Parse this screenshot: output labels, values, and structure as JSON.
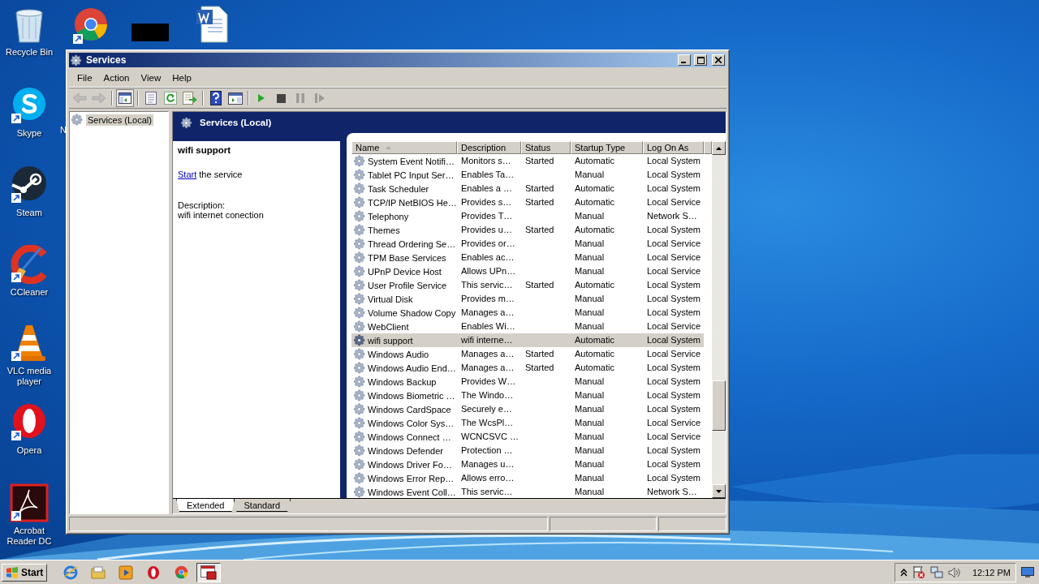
{
  "desktop_icons": [
    {
      "kind": "recycle",
      "label": "Recycle Bin"
    },
    {
      "kind": "chrome"
    },
    {
      "kind": "redacted"
    },
    {
      "kind": "word"
    },
    {
      "kind": "skype",
      "label": "Skype"
    },
    {
      "kind": "covered",
      "label": "N"
    },
    {
      "kind": "steam",
      "label": "Steam"
    },
    {
      "kind": "ccleaner",
      "label": "CCleaner"
    },
    {
      "kind": "vlc",
      "label": "VLC media player"
    },
    {
      "kind": "opera",
      "label": "Opera"
    },
    {
      "kind": "acrobat",
      "label": "Acrobat Reader DC"
    }
  ],
  "window": {
    "title": "Services",
    "menu": [
      "File",
      "Action",
      "View",
      "Help"
    ],
    "toolbar": [
      {
        "kind": "back",
        "disabled": true,
        "pressed": false
      },
      {
        "kind": "forward",
        "disabled": true,
        "pressed": false
      },
      {
        "kind": "tree",
        "disabled": false,
        "pressed": true
      },
      {
        "kind": "properties",
        "disabled": false,
        "pressed": false
      },
      {
        "kind": "refresh",
        "disabled": false,
        "pressed": false
      },
      {
        "kind": "export",
        "disabled": false,
        "pressed": false
      },
      {
        "kind": "help",
        "disabled": false,
        "pressed": false
      },
      {
        "kind": "console",
        "disabled": false,
        "pressed": false
      },
      {
        "kind": "play",
        "disabled": false,
        "pressed": false
      },
      {
        "kind": "stop",
        "disabled": false,
        "pressed": false
      },
      {
        "kind": "pause",
        "disabled": true,
        "pressed": false
      },
      {
        "kind": "resume",
        "disabled": true,
        "pressed": false
      }
    ],
    "tree": [
      {
        "label": "Services (Local)",
        "selected": true
      }
    ],
    "pane_title": "Services (Local)",
    "details": {
      "title": "wifi support",
      "action_link": "Start",
      "action_text": " the service",
      "description_label": "Description:",
      "description": "wifi internet conection"
    },
    "table": {
      "columns": [
        {
          "label": "Name",
          "sorted": true
        },
        {
          "label": "Description",
          "sorted": false
        },
        {
          "label": "Status",
          "sorted": false
        },
        {
          "label": "Startup Type",
          "sorted": false
        },
        {
          "label": "Log On As",
          "sorted": false
        }
      ],
      "rows": [
        {
          "name": "System Event Notifi…",
          "description": "Monitors s…",
          "status": "Started",
          "startup_type": "Automatic",
          "log_on_as": "Local System",
          "selected": false
        },
        {
          "name": "Tablet PC Input Ser…",
          "description": "Enables Ta…",
          "startup_type": "Manual",
          "log_on_as": "Local System",
          "selected": false
        },
        {
          "name": "Task Scheduler",
          "description": "Enables a …",
          "status": "Started",
          "startup_type": "Automatic",
          "log_on_as": "Local System",
          "selected": false
        },
        {
          "name": "TCP/IP NetBIOS He…",
          "description": "Provides s…",
          "status": "Started",
          "startup_type": "Automatic",
          "log_on_as": "Local Service",
          "selected": false
        },
        {
          "name": "Telephony",
          "description": "Provides T…",
          "startup_type": "Manual",
          "log_on_as": "Network S…",
          "selected": false
        },
        {
          "name": "Themes",
          "description": "Provides u…",
          "status": "Started",
          "startup_type": "Automatic",
          "log_on_as": "Local System",
          "selected": false
        },
        {
          "name": "Thread Ordering Se…",
          "description": "Provides or…",
          "startup_type": "Manual",
          "log_on_as": "Local Service",
          "selected": false
        },
        {
          "name": "TPM Base Services",
          "description": "Enables ac…",
          "startup_type": "Manual",
          "log_on_as": "Local Service",
          "selected": false
        },
        {
          "name": "UPnP Device Host",
          "description": "Allows UPn…",
          "startup_type": "Manual",
          "log_on_as": "Local Service",
          "selected": false
        },
        {
          "name": "User Profile Service",
          "description": "This servic…",
          "status": "Started",
          "startup_type": "Automatic",
          "log_on_as": "Local System",
          "selected": false
        },
        {
          "name": "Virtual Disk",
          "description": "Provides m…",
          "startup_type": "Manual",
          "log_on_as": "Local System",
          "selected": false
        },
        {
          "name": "Volume Shadow Copy",
          "description": "Manages a…",
          "startup_type": "Manual",
          "log_on_as": "Local System",
          "selected": false
        },
        {
          "name": "WebClient",
          "description": "Enables Wi…",
          "startup_type": "Manual",
          "log_on_as": "Local Service",
          "selected": false
        },
        {
          "name": "wifi support",
          "description": "wifi interne…",
          "startup_type": "Automatic",
          "log_on_as": "Local System",
          "selected": true
        },
        {
          "name": "Windows Audio",
          "description": "Manages a…",
          "status": "Started",
          "startup_type": "Automatic",
          "log_on_as": "Local Service",
          "selected": false
        },
        {
          "name": "Windows Audio End…",
          "description": "Manages a…",
          "status": "Started",
          "startup_type": "Automatic",
          "log_on_as": "Local System",
          "selected": false
        },
        {
          "name": "Windows Backup",
          "description": "Provides W…",
          "startup_type": "Manual",
          "log_on_as": "Local System",
          "selected": false
        },
        {
          "name": "Windows Biometric …",
          "description": "The Windo…",
          "startup_type": "Manual",
          "log_on_as": "Local System",
          "selected": false
        },
        {
          "name": "Windows CardSpace",
          "description": "Securely e…",
          "startup_type": "Manual",
          "log_on_as": "Local System",
          "selected": false
        },
        {
          "name": "Windows Color Sys…",
          "description": "The WcsPl…",
          "startup_type": "Manual",
          "log_on_as": "Local Service",
          "selected": false
        },
        {
          "name": "Windows Connect …",
          "description": "WCNCSVC …",
          "startup_type": "Manual",
          "log_on_as": "Local Service",
          "selected": false
        },
        {
          "name": "Windows Defender",
          "description": "Protection …",
          "startup_type": "Manual",
          "log_on_as": "Local System",
          "selected": false
        },
        {
          "name": "Windows Driver Fo…",
          "description": "Manages u…",
          "startup_type": "Manual",
          "log_on_as": "Local System",
          "selected": false
        },
        {
          "name": "Windows Error Rep…",
          "description": "Allows erro…",
          "startup_type": "Manual",
          "log_on_as": "Local System",
          "selected": false
        },
        {
          "name": "Windows Event Coll…",
          "description": "This servic…",
          "startup_type": "Manual",
          "log_on_as": "Network S…",
          "selected": false
        }
      ]
    },
    "tabs": [
      {
        "label": "Extended",
        "selected": true
      },
      {
        "label": "Standard",
        "selected": false
      }
    ]
  },
  "taskbar": {
    "start": "Start",
    "apps": [
      {
        "kind": "ie",
        "active": false
      },
      {
        "kind": "folder",
        "active": false
      },
      {
        "kind": "media",
        "active": false
      },
      {
        "kind": "opera",
        "active": false
      },
      {
        "kind": "chrome",
        "active": false
      },
      {
        "kind": "services",
        "active": true
      }
    ],
    "tray": [
      {
        "kind": "caret"
      },
      {
        "kind": "flag"
      },
      {
        "kind": "network"
      },
      {
        "kind": "speaker"
      }
    ],
    "time": "12:12 PM"
  }
}
